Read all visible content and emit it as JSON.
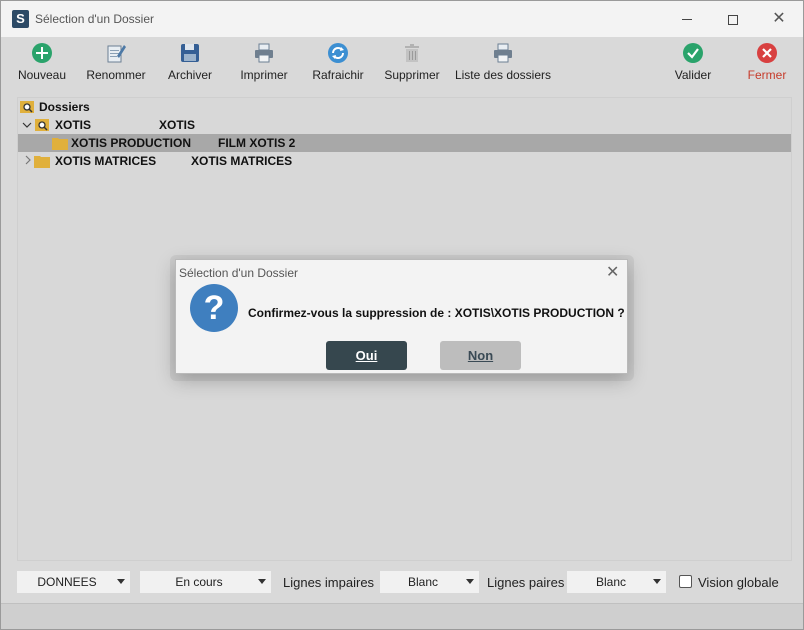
{
  "window": {
    "title": "Sélection d'un Dossier",
    "app_letter": "S"
  },
  "toolbar": {
    "nouveau": "Nouveau",
    "renommer": "Renommer",
    "archiver": "Archiver",
    "imprimer": "Imprimer",
    "rafraichir": "Rafraichir",
    "supprimer": "Supprimer",
    "liste": "Liste des dossiers",
    "valider": "Valider",
    "fermer": "Fermer"
  },
  "tree": {
    "root": "Dossiers",
    "rows": [
      {
        "name": "XOTIS",
        "desc": "XOTIS"
      },
      {
        "name": "XOTIS PRODUCTION",
        "desc": "FILM XOTIS 2"
      },
      {
        "name": "XOTIS MATRICES",
        "desc": "XOTIS MATRICES"
      }
    ]
  },
  "status": {
    "mode_select": "DONNEES",
    "state_select": "En cours",
    "odd_label": "Lignes impaires",
    "odd_select": "Blanc",
    "even_label": "Lignes paires",
    "even_select": "Blanc",
    "global_label": "Vision globale"
  },
  "dialog": {
    "title": "Sélection d'un Dossier",
    "message": "Confirmez-vous la suppression de :  XOTIS\\XOTIS PRODUCTION ?",
    "icon_glyph": "?",
    "yes": "Oui",
    "no": "Non"
  },
  "colors": {
    "nouveau": "#2aa36b",
    "valider": "#2aa36b",
    "fermer": "#d84040",
    "question": "#3f7fbf",
    "yes_button": "#36474e"
  }
}
